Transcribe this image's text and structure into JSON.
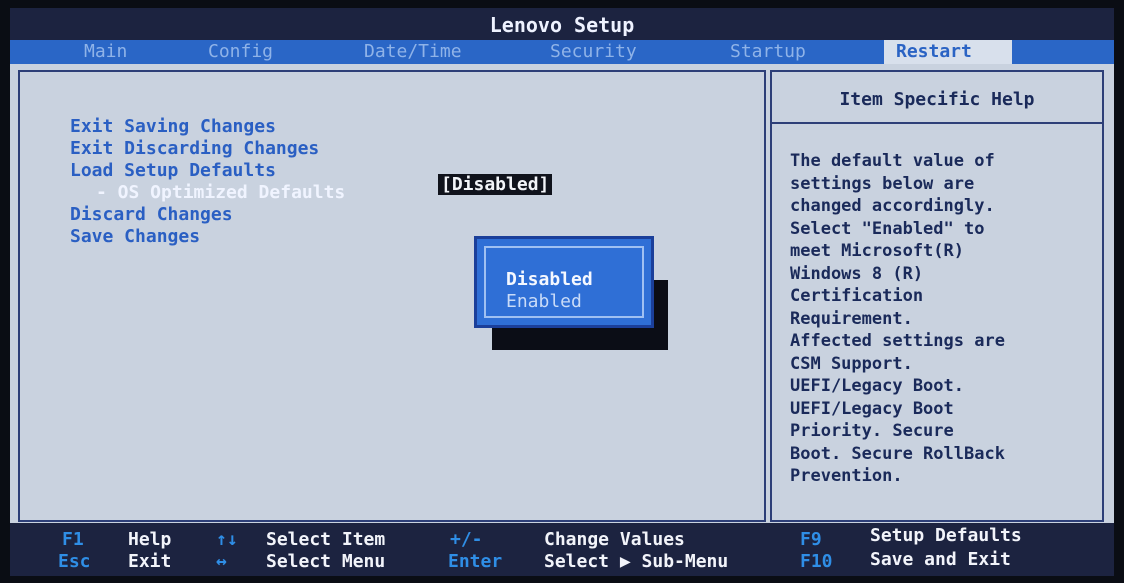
{
  "title": "Lenovo Setup",
  "tabs": [
    {
      "label": "Main"
    },
    {
      "label": "Config"
    },
    {
      "label": "Date/Time"
    },
    {
      "label": "Security"
    },
    {
      "label": "Startup"
    },
    {
      "label": "Restart",
      "active": true
    }
  ],
  "menu": {
    "items": [
      {
        "label": "Exit Saving Changes"
      },
      {
        "label": "Exit Discarding Changes"
      },
      {
        "label": "Load Setup Defaults"
      },
      {
        "label": "- OS Optimized Defaults",
        "value": "[Disabled]"
      },
      {
        "label": "Discard Changes"
      },
      {
        "label": "Save Changes"
      }
    ]
  },
  "popup": {
    "options": [
      "Disabled",
      "Enabled"
    ],
    "selected": "Disabled"
  },
  "help": {
    "header": "Item Specific Help",
    "text": "The default value of\nsettings below are\nchanged accordingly.\nSelect \"Enabled\" to\nmeet Microsoft(R)\nWindows 8 (R)\nCertification\nRequirement.\nAffected settings are\nCSM Support.\nUEFI/Legacy Boot.\nUEFI/Legacy Boot\nPriority. Secure\nBoot. Secure RollBack\nPrevention."
  },
  "footer": {
    "f1": {
      "key": "F1",
      "label": "Help"
    },
    "esc": {
      "key": "Esc",
      "label": "Exit"
    },
    "updown": {
      "key": "↑↓",
      "label": "Select Item"
    },
    "leftright": {
      "key": "↔",
      "label": "Select Menu"
    },
    "plusminus": {
      "key": "+/-",
      "label": "Change Values"
    },
    "enter": {
      "key": "Enter",
      "label": "Select ▶ Sub-Menu"
    },
    "f9": {
      "key": "F9",
      "label": "Setup Defaults"
    },
    "f10": {
      "key": "F10",
      "label": "Save and Exit"
    }
  },
  "colors": {
    "screen_bg": "#c9d2df",
    "menubar": "#2a66c6",
    "footer_bg": "#1c2340",
    "menu_text": "#2a5fc3",
    "key_text": "#2f8ee6"
  }
}
